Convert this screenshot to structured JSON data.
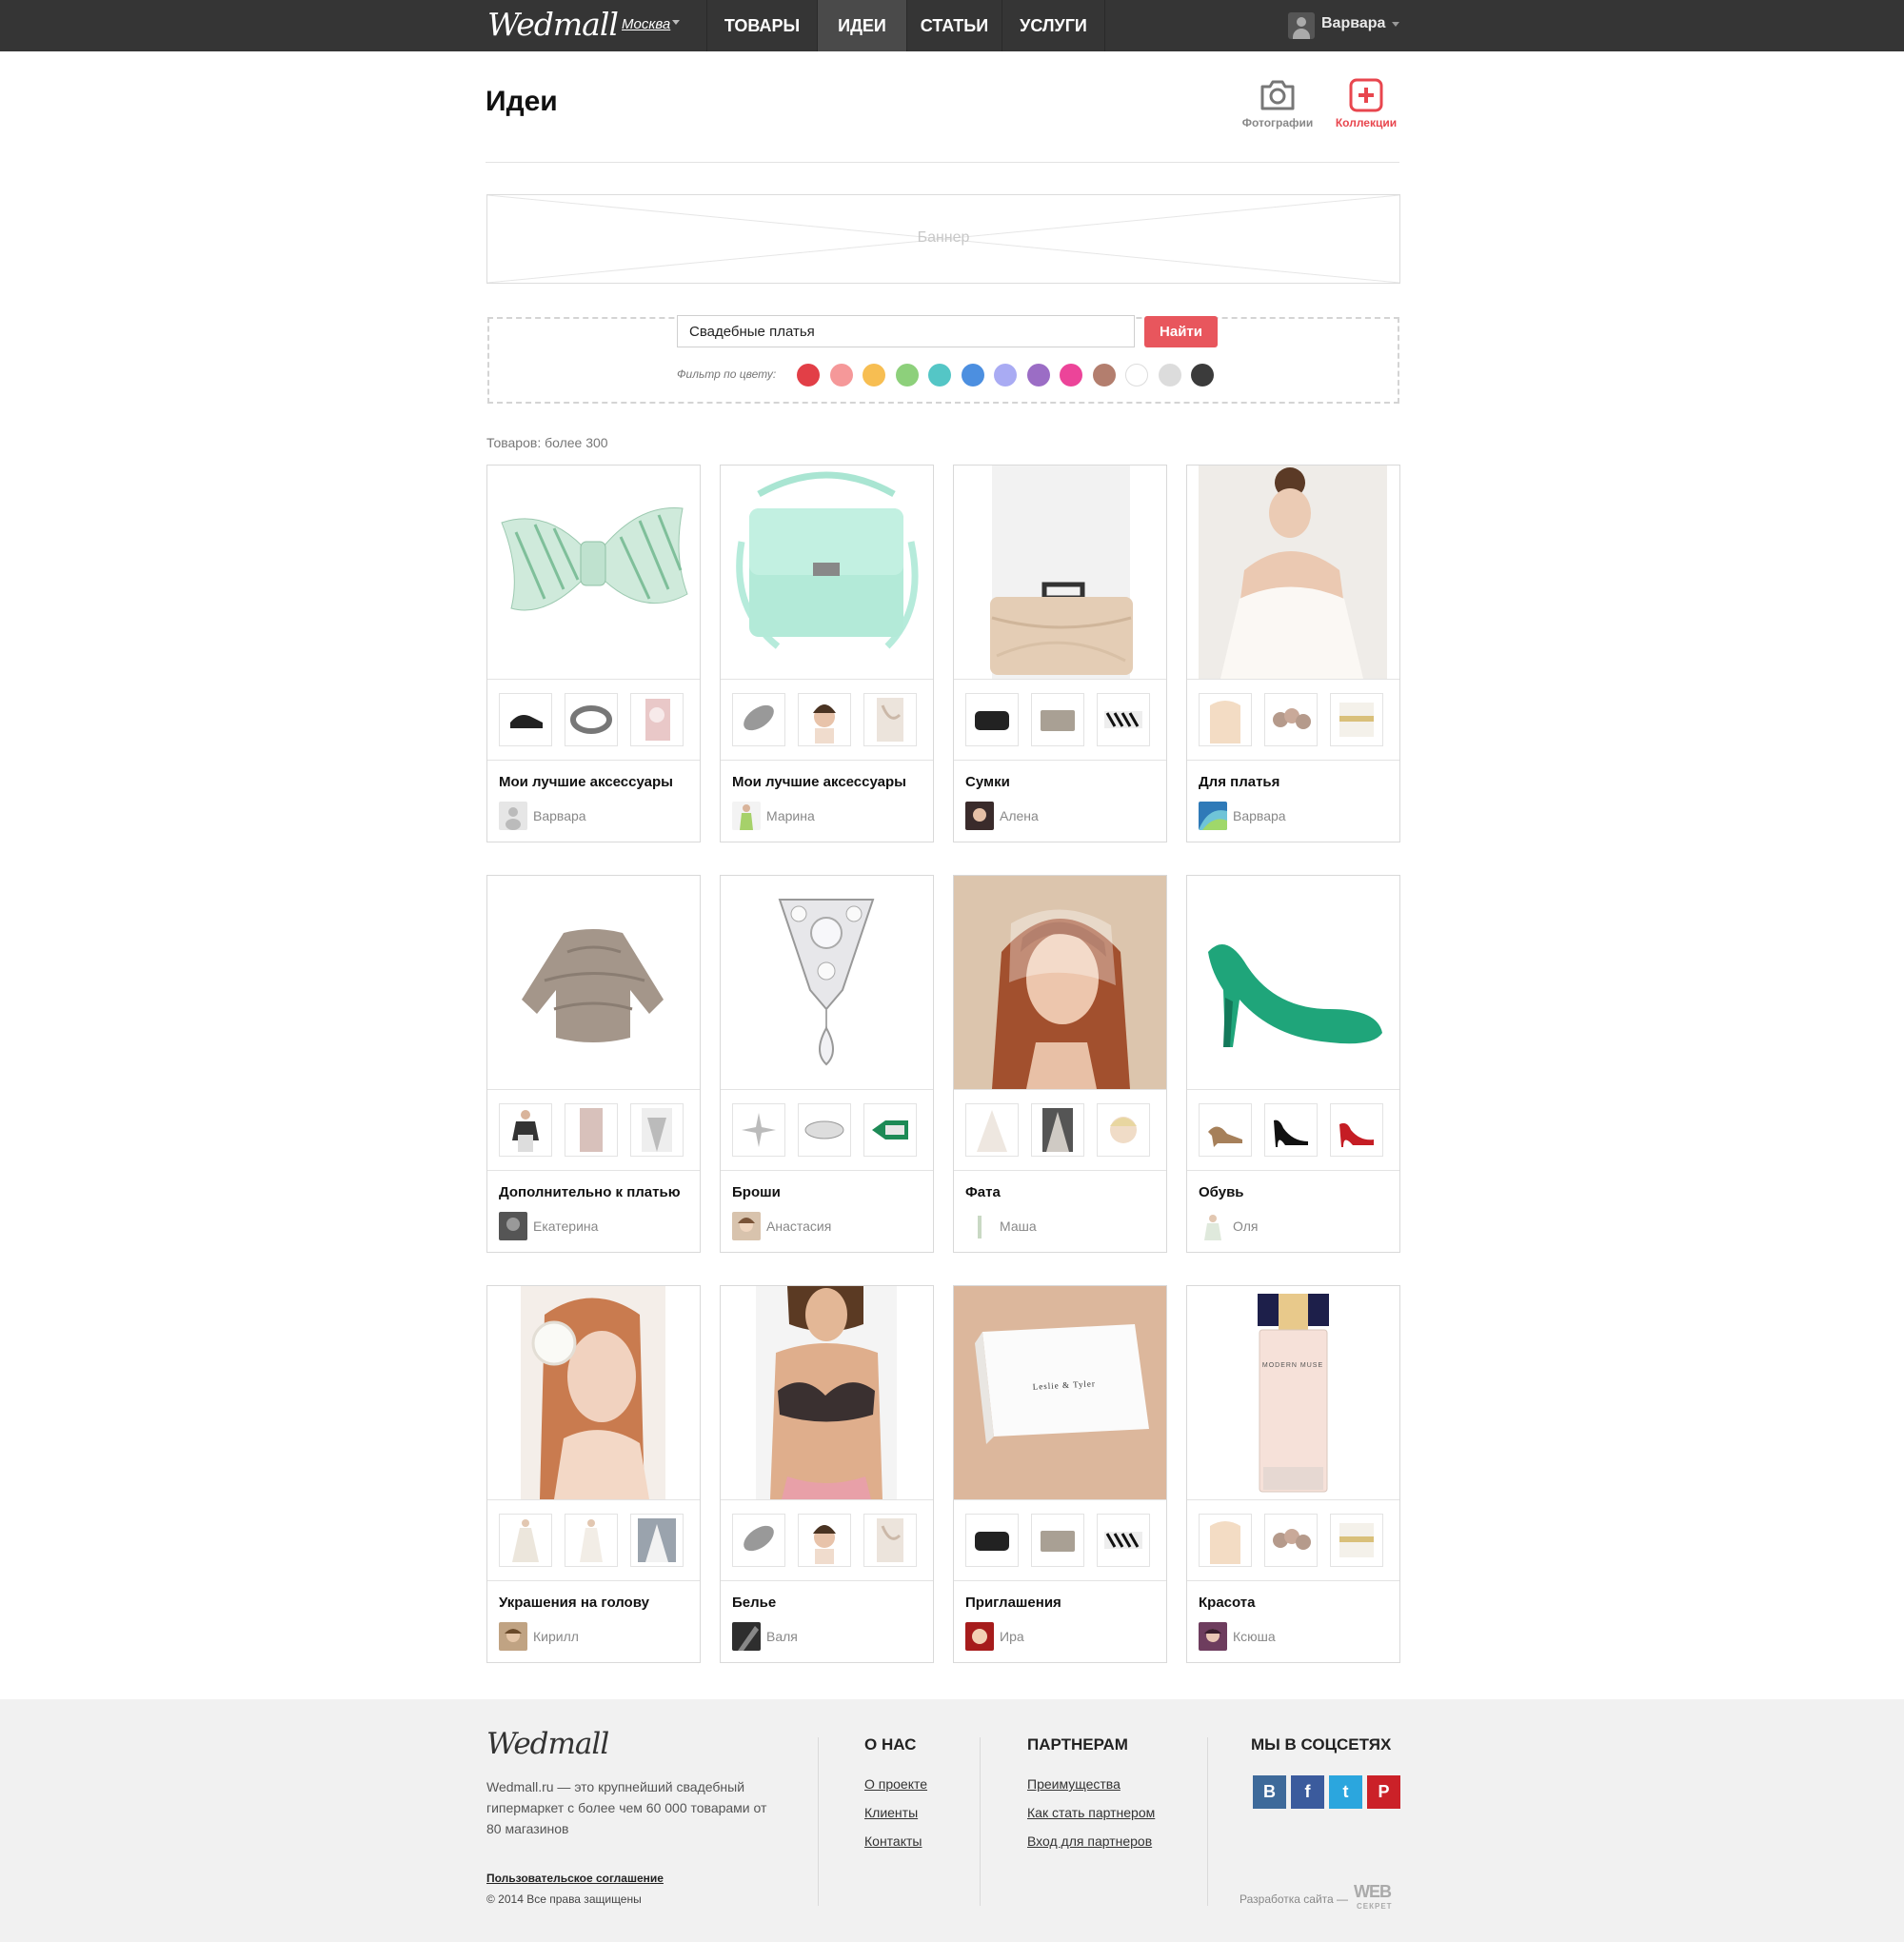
{
  "topbar": {
    "logo": "Wedmall",
    "city": "Москва",
    "tabs": [
      {
        "label": "ТОВАРЫ",
        "active": false
      },
      {
        "label": "ИДЕИ",
        "active": true
      },
      {
        "label": "СТАТЬИ",
        "active": false
      },
      {
        "label": "УСЛУГИ",
        "active": false
      }
    ],
    "user_name": "Варвара"
  },
  "header": {
    "title": "Идеи",
    "photos_label": "Фотографии",
    "collections_label": "Коллекции"
  },
  "banner": {
    "label": "Баннер"
  },
  "search": {
    "query": "Свадебные платья",
    "button_label": "Найти",
    "filter_label": "Фильтр по цвету:",
    "colors": [
      "#e23f47",
      "#f59899",
      "#f7be52",
      "#8dd07b",
      "#54c6c6",
      "#4c8fe0",
      "#a9abf3",
      "#9b6dc5",
      "#ec4499",
      "#b37e6e",
      "#ffffff",
      "#dcdcdc",
      "#3b3b3b"
    ]
  },
  "results": {
    "count_label": "Товаров: более 300",
    "cards": [
      {
        "title": "Мои лучшие аксессуары",
        "author": "Варвара"
      },
      {
        "title": "Мои лучшие аксессуары",
        "author": "Марина"
      },
      {
        "title": "Сумки",
        "author": "Алена"
      },
      {
        "title": "Для платья",
        "author": "Варвара"
      },
      {
        "title": "Дополнительно к платью",
        "author": "Екатерина"
      },
      {
        "title": "Броши",
        "author": "Анастасия"
      },
      {
        "title": "Фата",
        "author": "Маша"
      },
      {
        "title": "Обувь",
        "author": "Оля"
      },
      {
        "title": "Украшения на голову",
        "author": "Кирилл"
      },
      {
        "title": "Белье",
        "author": "Валя"
      },
      {
        "title": "Приглашения",
        "author": "Ира"
      },
      {
        "title": "Красота",
        "author": "Ксюша"
      }
    ],
    "invitation_text": "Leslie & Tyler",
    "perfume_text": "MODERN MUSE"
  },
  "footer": {
    "logo": "Wedmall",
    "description": "Wedmall.ru — это крупнейший свадебный гипермаркет с более чем 60 000 товарами от 80 магазинов",
    "agreement": "Пользовательское соглашение",
    "copyright": "© 2014 Все права защищены",
    "about": {
      "heading": "О НАС",
      "links": [
        "О проекте",
        "Клиенты",
        "Контакты"
      ]
    },
    "partners": {
      "heading": "ПАРТНЕРАМ",
      "links": [
        "Преимущества",
        "Как стать партнером",
        "Вход для партнеров"
      ]
    },
    "social": {
      "heading": "МЫ В СОЦСЕТЯХ",
      "items": [
        {
          "glyph": "B",
          "color": "#3e6a9a",
          "icon": "vk-icon"
        },
        {
          "glyph": "f",
          "color": "#3b5b9d",
          "icon": "facebook-icon"
        },
        {
          "glyph": "t",
          "color": "#2ba6de",
          "icon": "twitter-icon"
        },
        {
          "glyph": "P",
          "color": "#cb2128",
          "icon": "pinterest-icon"
        }
      ]
    },
    "dev_label": "Разработка сайта —",
    "dev_logo": "WEB",
    "dev_logo_sub": "СЕКРЕТ"
  }
}
